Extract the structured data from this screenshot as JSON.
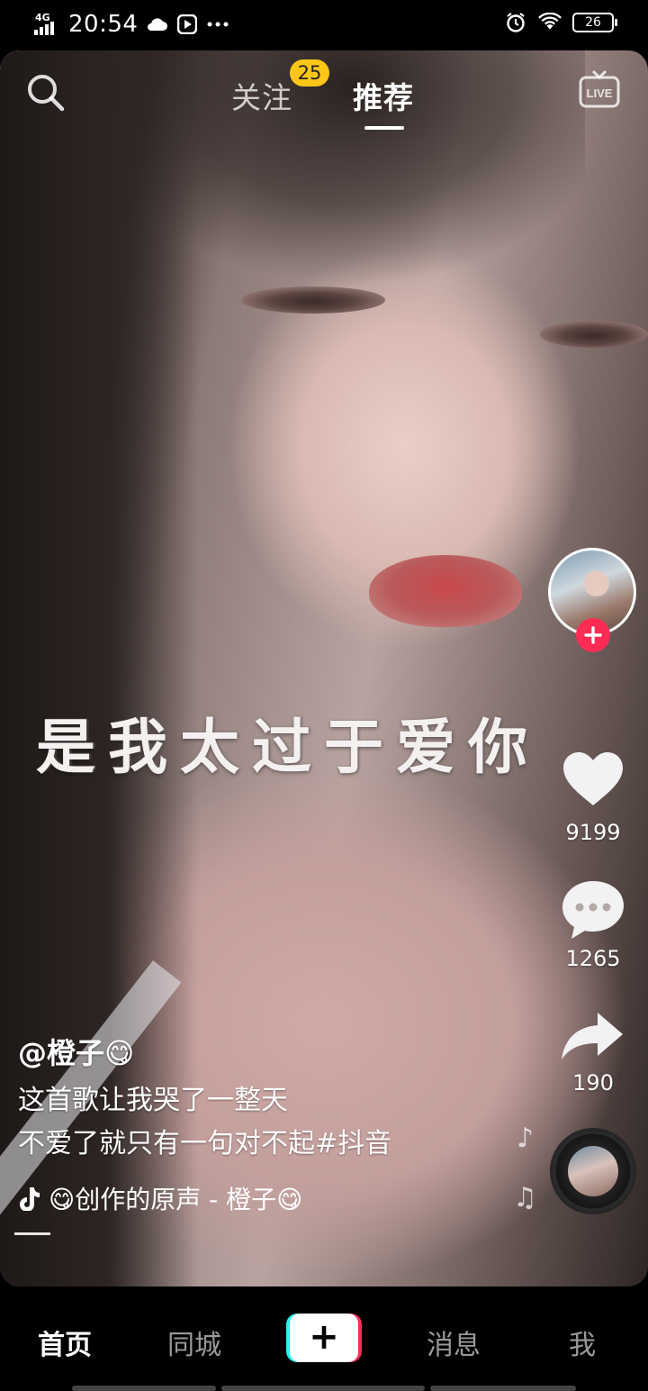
{
  "status_bar": {
    "network": "4G",
    "time": "20:54",
    "battery": "26",
    "icons": [
      "signal-icon",
      "cloud-icon",
      "media-icon",
      "more-dots-icon",
      "alarm-icon",
      "wifi-icon",
      "battery-icon"
    ]
  },
  "header": {
    "tabs": [
      {
        "label": "关注",
        "badge": "25",
        "active": false
      },
      {
        "label": "推荐",
        "active": true
      }
    ],
    "left_icon": "search-icon",
    "right_icon": "live-icon",
    "live_label": "LIVE"
  },
  "video": {
    "caption": "是我太过于爱你"
  },
  "sidebar": {
    "likes": "9199",
    "comments": "1265",
    "shares": "190",
    "follow_icon": "plus-icon"
  },
  "post": {
    "author": "@橙子😋",
    "description_line1": "这首歌让我哭了一整天",
    "description_line2": "不爱了就只有一句对不起#抖音",
    "music": "😋创作的原声 - 橙子😋"
  },
  "bottom_nav": {
    "items": [
      "首页",
      "同城",
      "消息",
      "我"
    ],
    "active": "首页",
    "add_label": "+"
  },
  "colors": {
    "accent_red": "#fe2c55",
    "accent_cyan": "#25f4ee",
    "badge_yellow": "#ffc617"
  }
}
